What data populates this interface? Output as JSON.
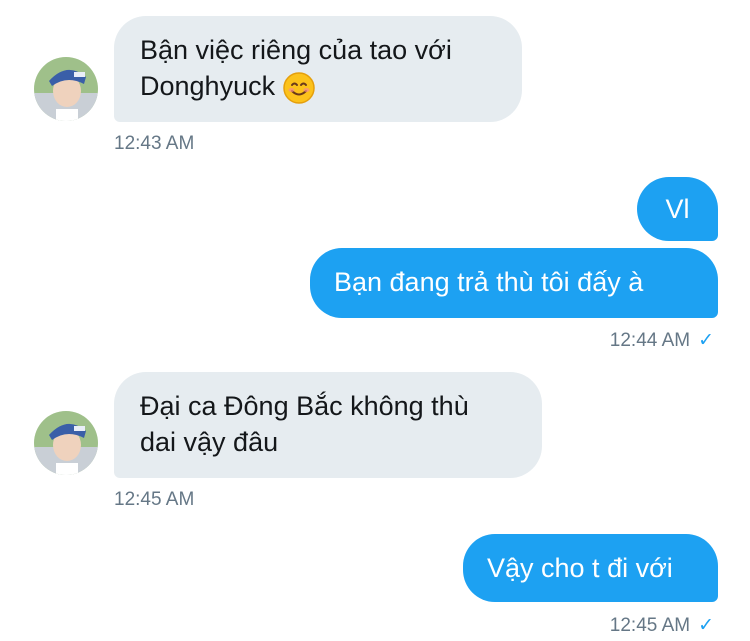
{
  "messages": [
    {
      "side": "in",
      "lines": [
        "Bận việc riêng của tao với",
        "Donghyuck"
      ],
      "emoji": "smiling-face-emoji",
      "time": "12:43 AM"
    },
    {
      "side": "out",
      "lines": [
        "Vl"
      ]
    },
    {
      "side": "out",
      "lines": [
        "Bạn đang trả thù tôi đấy à"
      ],
      "time": "12:44 AM",
      "read": "✓"
    },
    {
      "side": "in",
      "lines": [
        "Đại ca Đông Bắc không thù",
        "dai vậy đâu"
      ],
      "time": "12:45 AM"
    },
    {
      "side": "out",
      "lines": [
        "Vậy cho t đi với"
      ],
      "time": "12:45 AM",
      "read": "✓"
    }
  ],
  "colors": {
    "incoming_bubble": "#e6ecf0",
    "outgoing_bubble": "#1da1f2",
    "timestamp": "#657786"
  }
}
